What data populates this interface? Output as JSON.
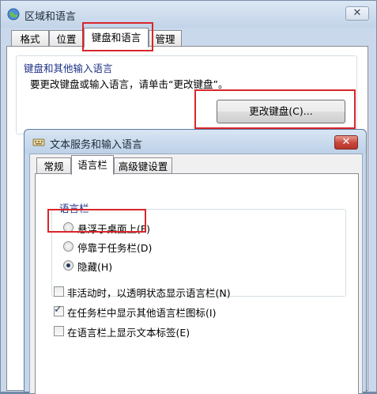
{
  "outer_window": {
    "title": "区域和语言",
    "close_glyph": "✕",
    "tabs": [
      {
        "label": "格式"
      },
      {
        "label": "位置"
      },
      {
        "label": "键盘和语言",
        "active": true
      },
      {
        "label": "管理"
      }
    ],
    "keyboard_group": {
      "title": "键盘和其他输入语言",
      "description": "要更改键盘或输入语言，请单击“更改键盘”。",
      "change_button": "更改键盘(C)..."
    }
  },
  "inner_dialog": {
    "title": "文本服务和输入语言",
    "close_glyph": "✕",
    "tabs": [
      {
        "label": "常规"
      },
      {
        "label": "语言栏",
        "active": true
      },
      {
        "label": "高级键设置"
      }
    ],
    "language_bar_group": {
      "title": "语言栏",
      "options": [
        {
          "label": "悬浮于桌面上(F)",
          "checked": false
        },
        {
          "label": "停靠于任务栏(D)",
          "checked": false
        },
        {
          "label": "隐藏(H)",
          "checked": true
        }
      ]
    },
    "checkboxes": [
      {
        "label": "非活动时，以透明状态显示语言栏(N)",
        "checked": false
      },
      {
        "label": "在任务栏中显示其他语言栏图标(I)",
        "checked": true
      },
      {
        "label": "在语言栏上显示文本标签(E)",
        "checked": false
      }
    ]
  },
  "colors": {
    "highlight_box": "#d9262b",
    "group_title": "#1e3287"
  }
}
